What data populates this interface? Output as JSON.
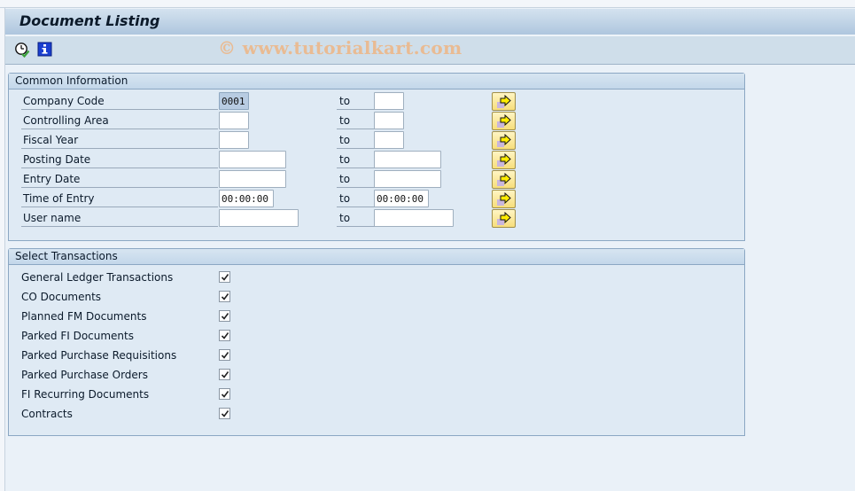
{
  "window": {
    "title": "Document Listing"
  },
  "toolbar": {
    "buttons": [
      {
        "icon": "execute-clock-icon",
        "tooltip": ""
      },
      {
        "icon": "info-icon",
        "tooltip": ""
      }
    ]
  },
  "watermark": "© www.tutorialkart.com",
  "common_information": {
    "title": "Common Information",
    "to_label": "to",
    "rows": [
      {
        "label": "Company Code",
        "from": "0001",
        "to": ""
      },
      {
        "label": "Controlling Area",
        "from": "",
        "to": ""
      },
      {
        "label": "Fiscal Year",
        "from": "",
        "to": ""
      },
      {
        "label": "Posting Date",
        "from": "",
        "to": ""
      },
      {
        "label": "Entry Date",
        "from": "",
        "to": ""
      },
      {
        "label": "Time of Entry",
        "from": "00:00:00",
        "to": "00:00:00"
      },
      {
        "label": "User name",
        "from": "",
        "to": ""
      }
    ]
  },
  "select_transactions": {
    "title": "Select Transactions",
    "items": [
      {
        "label": "General Ledger Transactions",
        "checked": true
      },
      {
        "label": "CO Documents",
        "checked": true
      },
      {
        "label": "Planned FM Documents",
        "checked": true
      },
      {
        "label": "Parked FI Documents",
        "checked": true
      },
      {
        "label": "Parked Purchase Requisitions",
        "checked": true
      },
      {
        "label": "Parked Purchase Orders",
        "checked": true
      },
      {
        "label": "FI Recurring Documents",
        "checked": true
      },
      {
        "label": "Contracts",
        "checked": true
      }
    ]
  },
  "colors": {
    "background": "#eaf1f8",
    "group_background": "#dfeaf4",
    "multiselect_button": "#f7de7a",
    "selected_input": "#b8cce2"
  }
}
